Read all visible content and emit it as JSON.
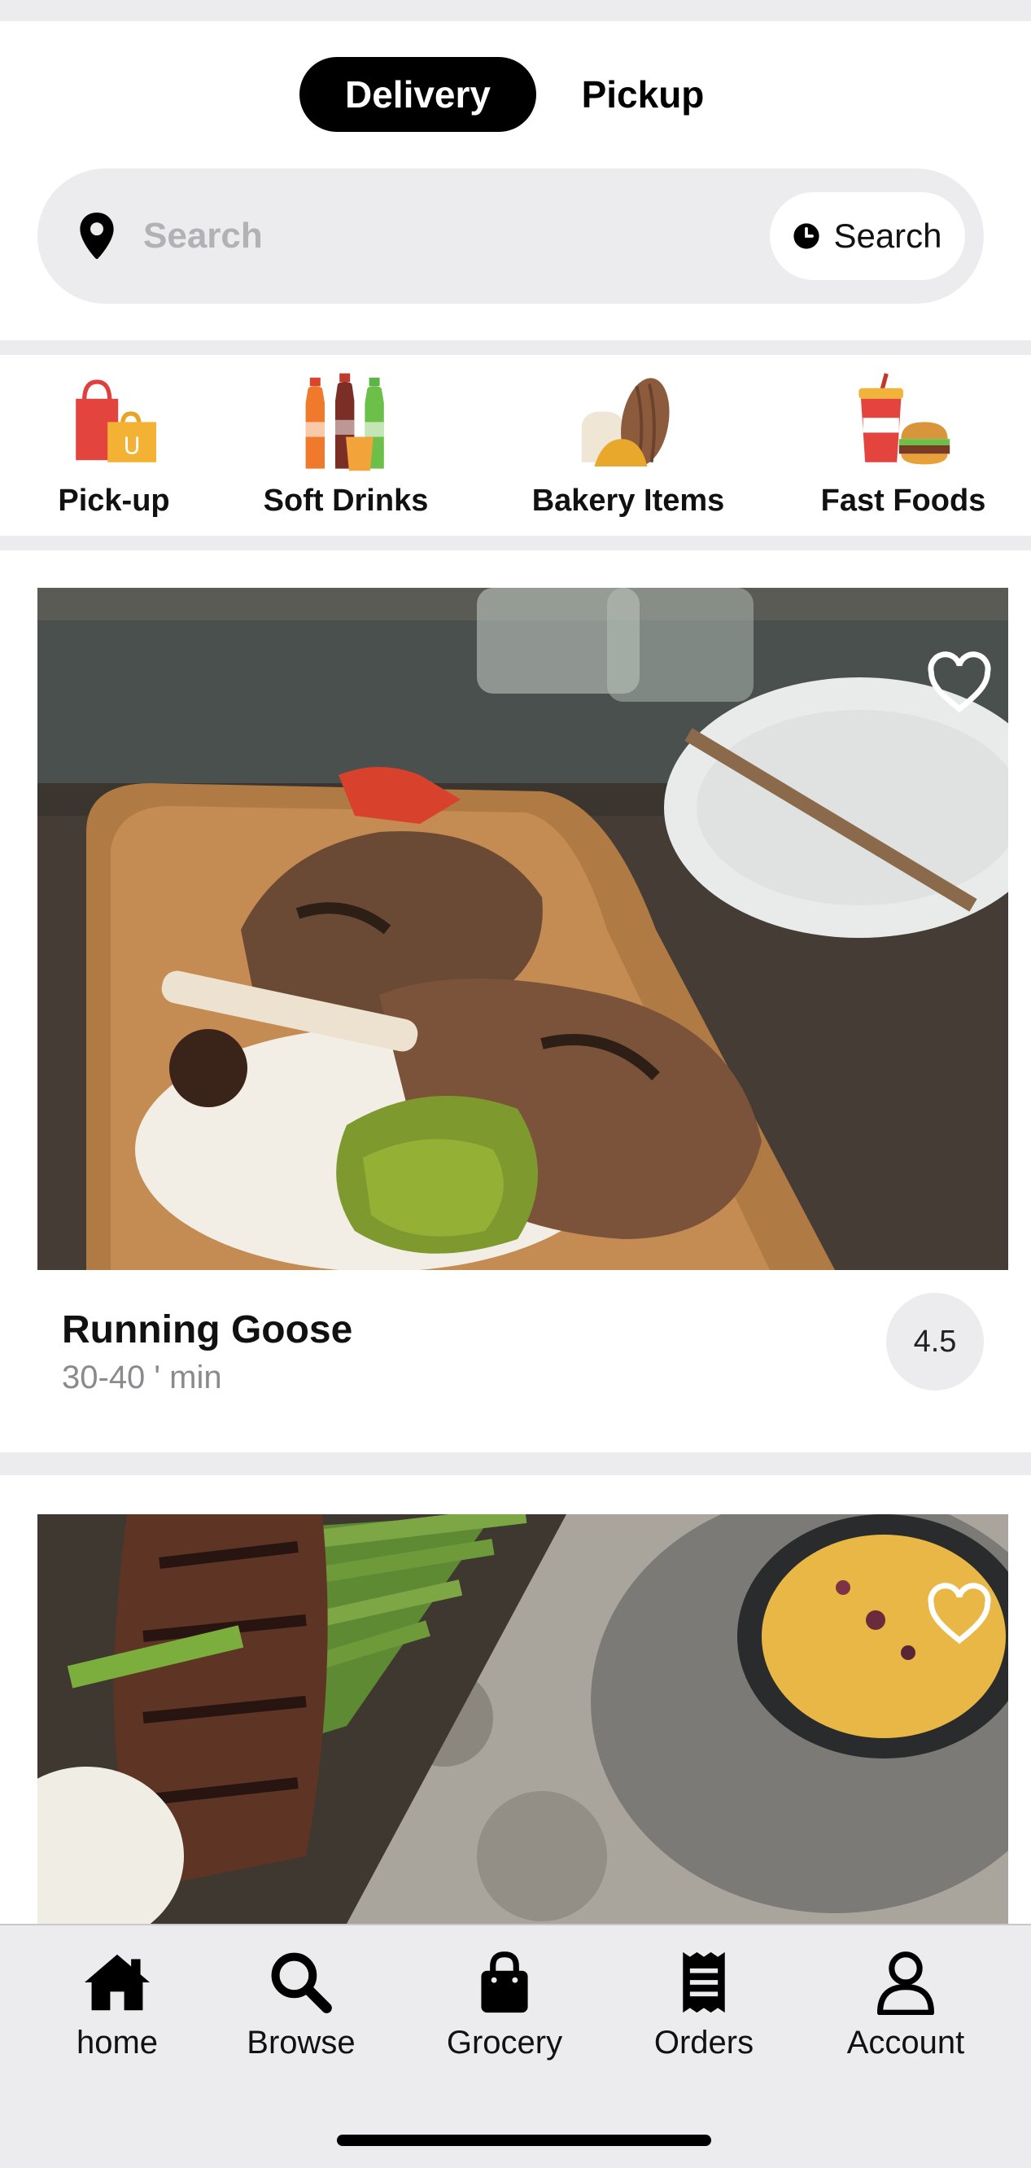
{
  "mode_toggle": {
    "delivery_label": "Delivery",
    "pickup_label": "Pickup",
    "selected": "Delivery"
  },
  "search": {
    "placeholder": "Search",
    "value": "",
    "schedule_label": "Search",
    "location_icon": "map-pin-icon",
    "schedule_icon": "clock-icon"
  },
  "categories": [
    {
      "label": "Pick-up",
      "icon": "shopping-bags-icon"
    },
    {
      "label": "Soft Drinks",
      "icon": "soda-bottles-icon"
    },
    {
      "label": "Bakery Items",
      "icon": "bread-icon"
    },
    {
      "label": "Fast Foods",
      "icon": "fast-food-icon"
    }
  ],
  "restaurants": [
    {
      "name": "Running Goose",
      "delivery_time": "30-40 ' min",
      "rating": "4.5",
      "favorite_icon": "heart-outline-icon",
      "image": "grilled-lamb-chops-photo"
    },
    {
      "name": "",
      "delivery_time": "",
      "rating": "",
      "favorite_icon": "heart-outline-icon",
      "image": "steak-asparagus-soup-photo"
    }
  ],
  "tab_bar": [
    {
      "label": "home",
      "icon": "house-icon"
    },
    {
      "label": "Browse",
      "icon": "magnifier-icon"
    },
    {
      "label": "Grocery",
      "icon": "shopping-bag-icon"
    },
    {
      "label": "Orders",
      "icon": "receipt-icon"
    },
    {
      "label": "Account",
      "icon": "person-icon"
    }
  ],
  "colors": {
    "accent": "#000000",
    "surface_gray": "#ecebee",
    "muted_text": "#8a8a8e",
    "placeholder_text": "#b2b2b6"
  }
}
